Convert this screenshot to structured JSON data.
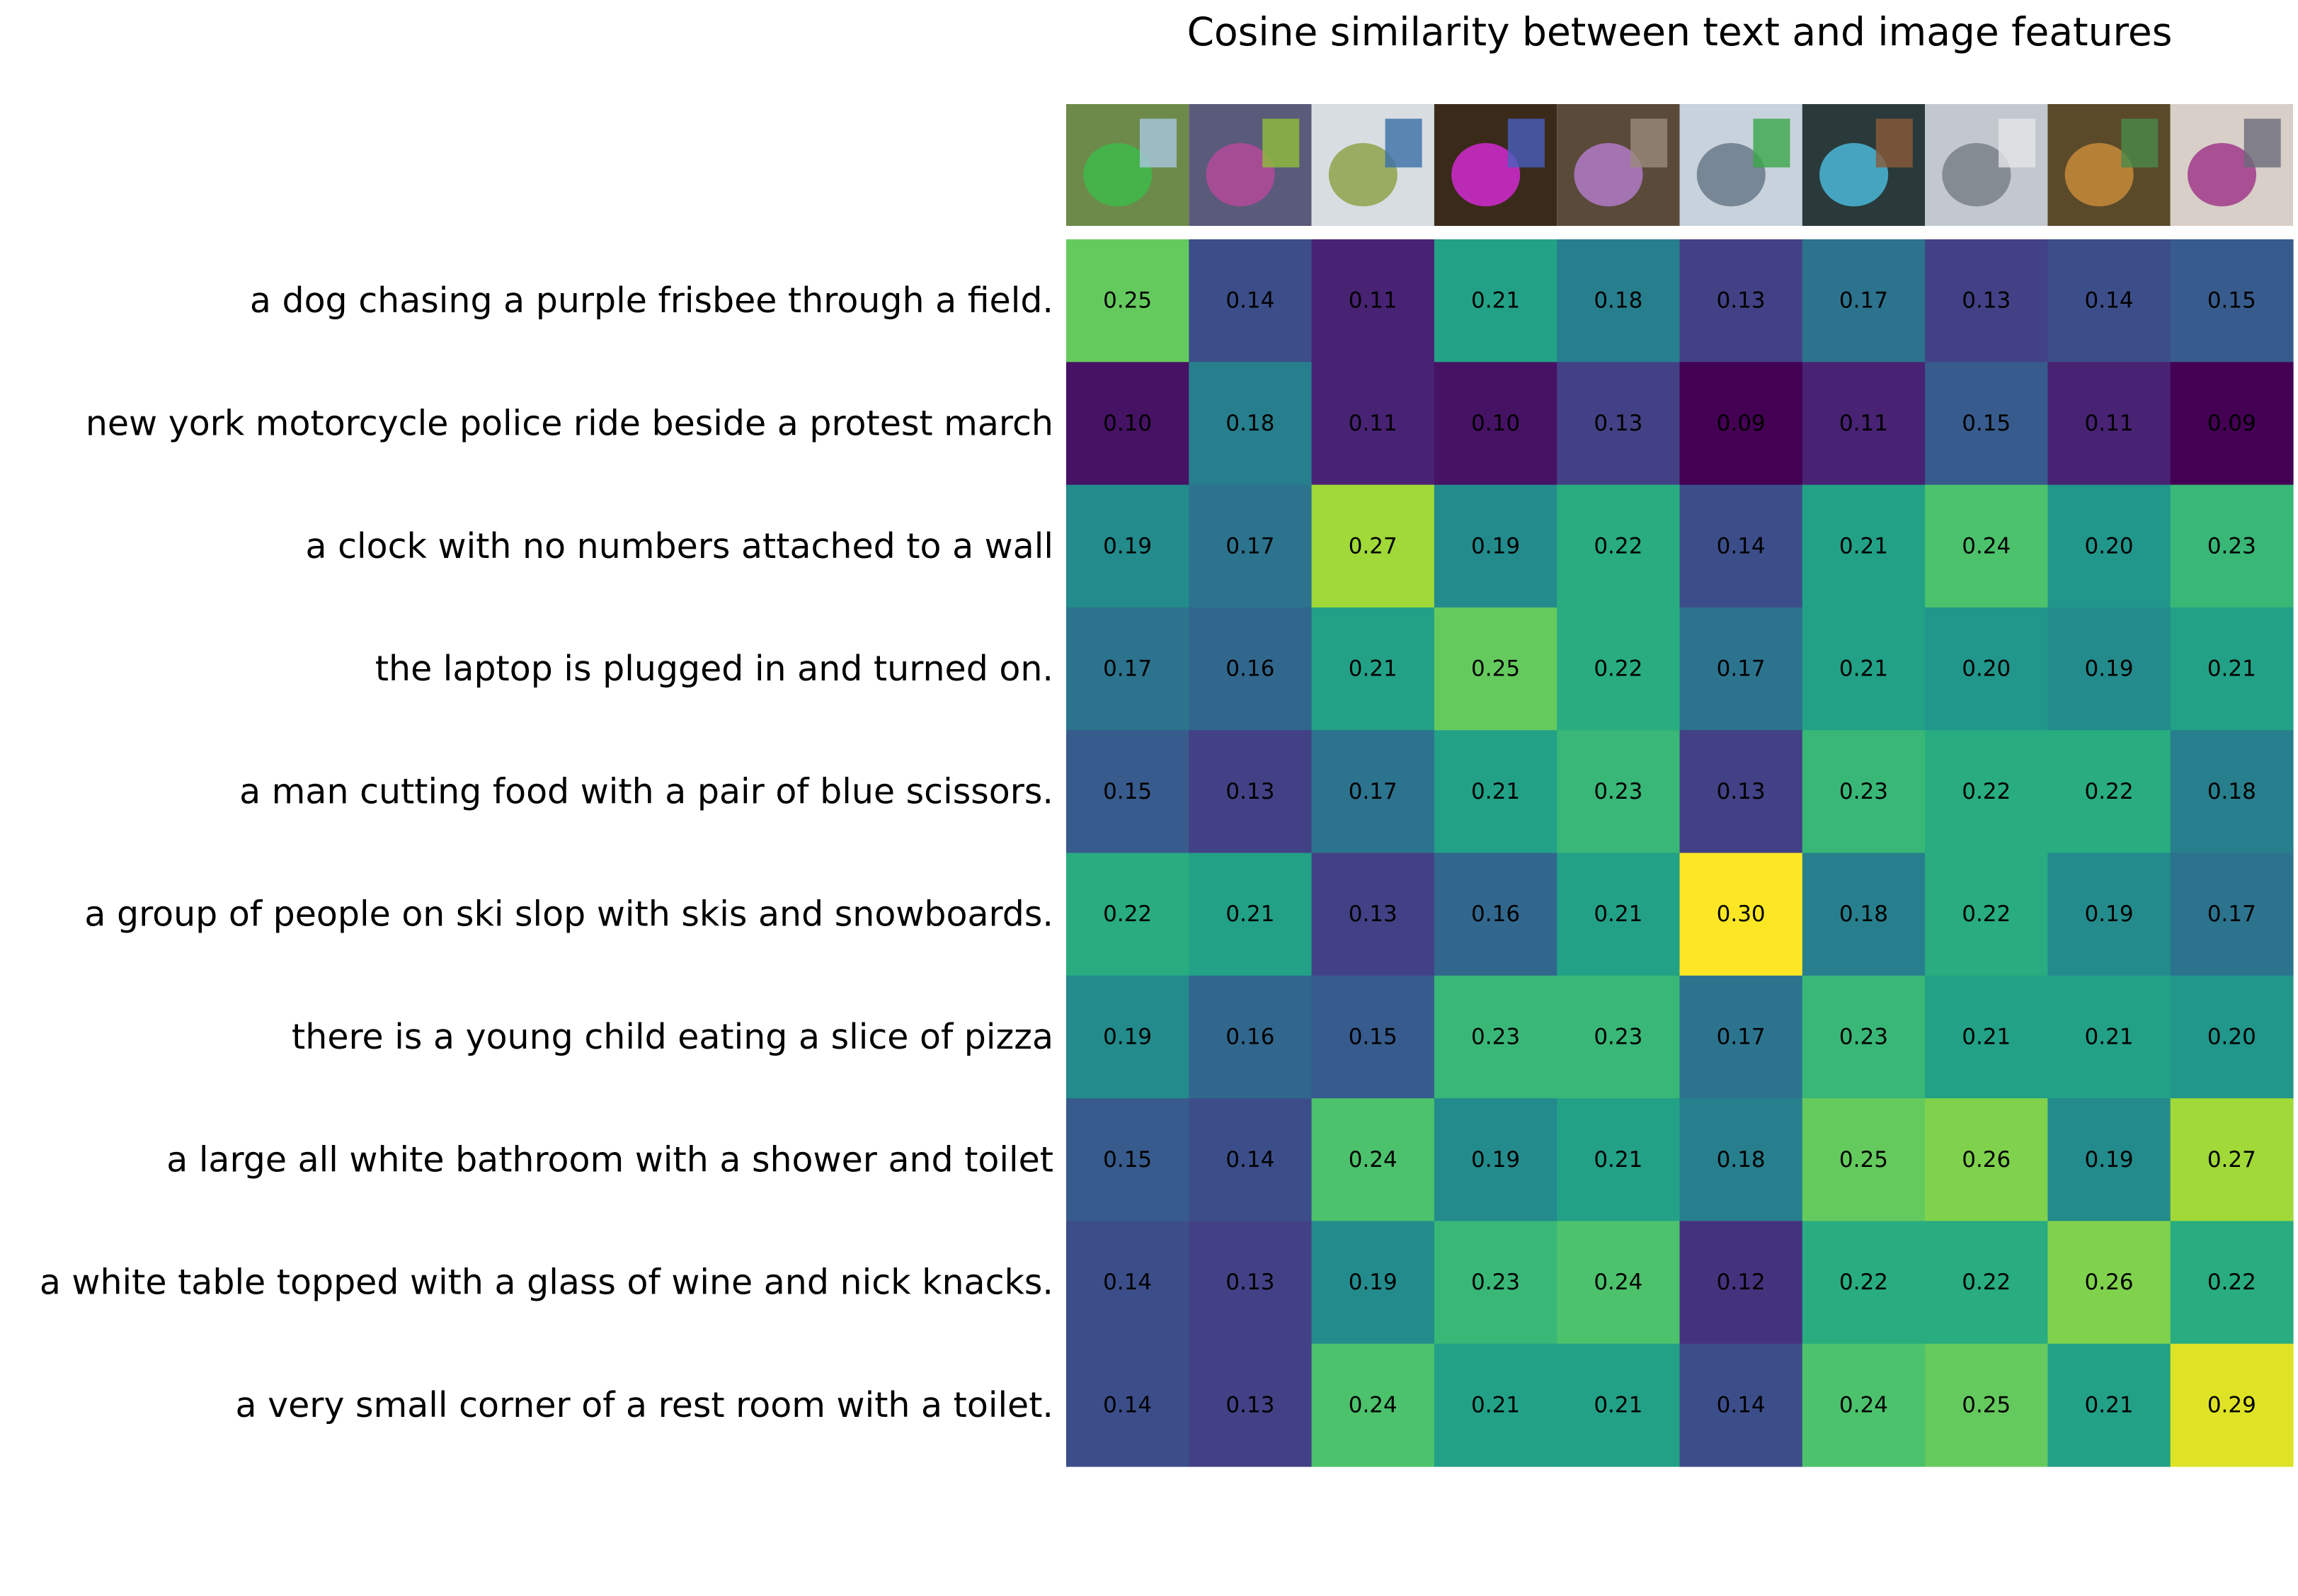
{
  "chart_data": {
    "type": "heatmap",
    "title": "Cosine similarity between text and image features",
    "xlabel": "",
    "ylabel": "",
    "colormap": "viridis",
    "vlim": [
      0.09,
      0.3
    ],
    "rows": [
      "a dog chasing a purple frisbee through a field.",
      "new york motorcycle police ride beside a protest march",
      "a clock with no numbers attached to a wall",
      "the laptop is plugged in and turned on.",
      "a man cutting food with a pair of blue scissors.",
      "a group of people on ski slop with skis and snowboards.",
      "there is a young child eating a slice of pizza",
      "a large all white bathroom with a shower and toilet",
      "a white table topped with a glass of wine and nick knacks.",
      "a very small corner of a rest room with a toilet."
    ],
    "values": [
      [
        0.25,
        0.14,
        0.11,
        0.21,
        0.18,
        0.13,
        0.17,
        0.13,
        0.14,
        0.15
      ],
      [
        0.1,
        0.18,
        0.11,
        0.1,
        0.13,
        0.09,
        0.11,
        0.15,
        0.11,
        0.09
      ],
      [
        0.19,
        0.17,
        0.27,
        0.19,
        0.22,
        0.14,
        0.21,
        0.24,
        0.2,
        0.23
      ],
      [
        0.17,
        0.16,
        0.21,
        0.25,
        0.22,
        0.17,
        0.21,
        0.2,
        0.19,
        0.21
      ],
      [
        0.15,
        0.13,
        0.17,
        0.21,
        0.23,
        0.13,
        0.23,
        0.22,
        0.22,
        0.18
      ],
      [
        0.22,
        0.21,
        0.13,
        0.16,
        0.21,
        0.3,
        0.18,
        0.22,
        0.19,
        0.17
      ],
      [
        0.19,
        0.16,
        0.15,
        0.23,
        0.23,
        0.17,
        0.23,
        0.21,
        0.21,
        0.2
      ],
      [
        0.15,
        0.14,
        0.24,
        0.19,
        0.21,
        0.18,
        0.25,
        0.26,
        0.19,
        0.27
      ],
      [
        0.14,
        0.13,
        0.19,
        0.23,
        0.24,
        0.12,
        0.22,
        0.22,
        0.26,
        0.22
      ],
      [
        0.14,
        0.13,
        0.24,
        0.21,
        0.21,
        0.14,
        0.24,
        0.25,
        0.21,
        0.29
      ]
    ],
    "column_images": [
      "field-with-dog-thumbnail",
      "protest-march-thumbnail",
      "wall-clock-thumbnail",
      "laptop-thumbnail",
      "scissors-thumbnail",
      "ski-slope-thumbnail",
      "pizza-child-thumbnail",
      "bathroom-thumbnail",
      "wine-table-thumbnail",
      "toilet-corner-thumbnail"
    ]
  }
}
